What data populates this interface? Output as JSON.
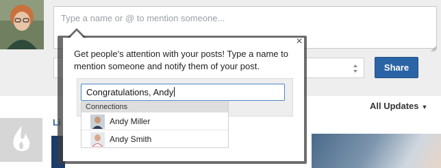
{
  "composer": {
    "placeholder": "Type a name or @ to mention someone...",
    "share_label": "Share"
  },
  "feed": {
    "filter_label": "All Updates",
    "link_fragment": "Li"
  },
  "tooltip": {
    "message": "Get people's attention with your posts! Type a name to mention someone and notify them of your post.",
    "demo_input_value": "Congratulations, Andy",
    "dropdown": {
      "header": "Connections",
      "items": [
        {
          "name": "Andy Miller"
        },
        {
          "name": "Andy Smith"
        }
      ]
    }
  },
  "icons": {
    "close": "close-icon",
    "select_arrows": "up-down-arrows-icon",
    "filter_caret": "caret-down-icon",
    "company_logo": "flame-logo-icon"
  },
  "colors": {
    "share_button": "#2b64a6",
    "link": "#2b64a6",
    "input_focus_border": "#4a86c7"
  }
}
